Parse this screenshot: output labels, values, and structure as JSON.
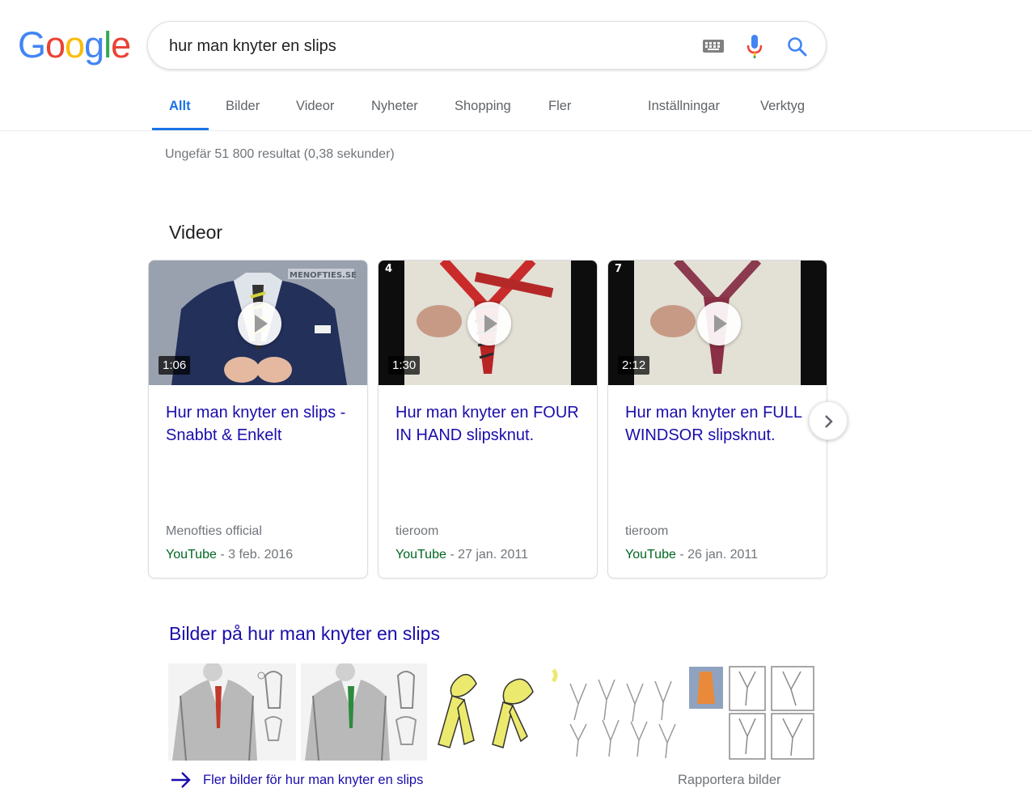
{
  "logo": {
    "text": "Google"
  },
  "search": {
    "value": "hur man knyter en slips"
  },
  "tabs": [
    {
      "label": "Allt",
      "active": true
    },
    {
      "label": "Bilder"
    },
    {
      "label": "Videor"
    },
    {
      "label": "Nyheter"
    },
    {
      "label": "Shopping"
    },
    {
      "label": "Fler"
    },
    {
      "label": "Inställningar"
    },
    {
      "label": "Verktyg"
    }
  ],
  "result_stats": "Ungefär 51 800 resultat (0,38 sekunder)",
  "videos": {
    "heading": "Videor",
    "items": [
      {
        "duration": "1:06",
        "title": "Hur man knyter en slips - Snabbt & Enkelt",
        "channel": "Menofties official",
        "source": "YouTube",
        "date": " - 3 feb. 2016",
        "watermark": "MENOFTIES.SE"
      },
      {
        "duration": "1:30",
        "title": "Hur man knyter en FOUR IN HAND slipsknut.",
        "channel": "tieroom",
        "source": "YouTube",
        "date": " - 27 jan. 2011",
        "step": "4"
      },
      {
        "duration": "2:12",
        "title": "Hur man knyter en FULL WINDSOR slipsknut.",
        "channel": "tieroom",
        "source": "YouTube",
        "date": " - 26 jan. 2011",
        "step": "7"
      }
    ]
  },
  "images": {
    "heading": "Bilder på hur man knyter en slips",
    "more_label": "Fler bilder för hur man knyter en slips",
    "report_label": "Rapportera bilder"
  },
  "colors": {
    "link": "#1a0dab",
    "active_tab": "#1a73e8",
    "url_green": "#006621",
    "muted": "#70757a"
  },
  "icons": [
    "keyboard-icon",
    "microphone-icon",
    "search-icon",
    "play-icon",
    "chevron-right-icon",
    "arrow-right-icon"
  ]
}
